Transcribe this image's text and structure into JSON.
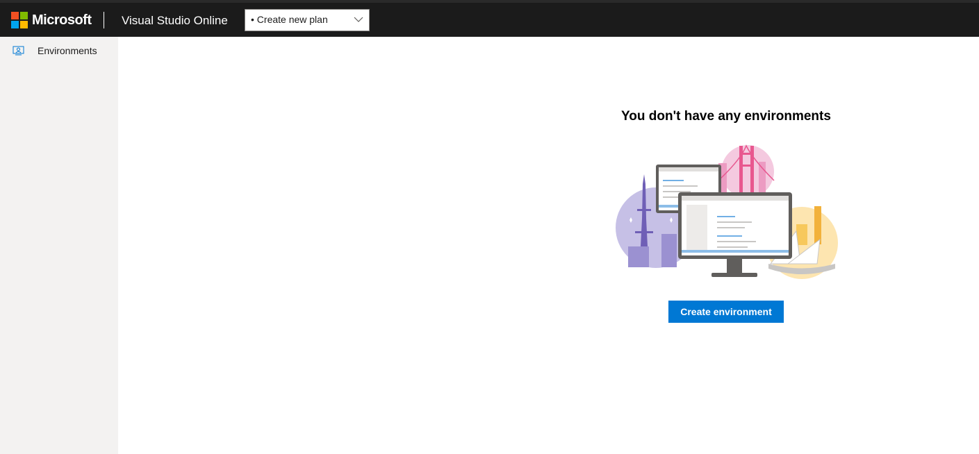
{
  "header": {
    "brand": "Microsoft",
    "product_title": "Visual Studio Online",
    "plan_select": {
      "selected": "• Create new plan"
    }
  },
  "sidebar": {
    "items": [
      {
        "label": "Environments",
        "icon": "environments-icon"
      }
    ]
  },
  "main": {
    "empty_title": "You don't have any environments",
    "illustration": "cities-monitors-illustration",
    "create_button_label": "Create environment"
  },
  "colors": {
    "topbar_bg": "#1b1b1b",
    "sidebar_bg": "#f3f2f1",
    "accent": "#0078d4",
    "logo_red": "#f25022",
    "logo_green": "#7fba00",
    "logo_blue": "#00a4ef",
    "logo_yellow": "#ffb900"
  }
}
